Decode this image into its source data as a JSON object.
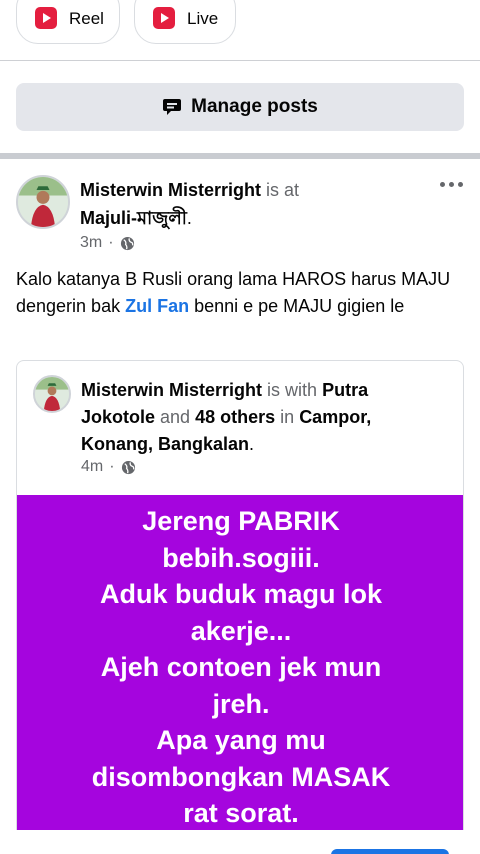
{
  "top_chips": [
    {
      "label": "Reel",
      "icon": "reel-icon"
    },
    {
      "label": "Live",
      "icon": "live-video-icon"
    }
  ],
  "manage": {
    "label": "Manage posts",
    "icon": "speech-bubble-icon"
  },
  "post": {
    "author": "Misterwin Misterright",
    "is_at": "is at",
    "location": "Majuli-মাজুলী",
    "location_suffix": ".",
    "time": "3m",
    "dot": "·",
    "text_part1": "Kalo katanya B Rusli orang lama HAROS harus MAJU dengerin bak ",
    "mention": "Zul Fan",
    "text_part2": " benni e pe MAJU gigien le",
    "audience_icon": "globe-icon"
  },
  "shared": {
    "author": "Misterwin Misterright",
    "is_with": "is with",
    "tagged": "Putra Jokotole",
    "and": "and",
    "others": "48 others",
    "in": "in",
    "place": "Campor, Konang, Bangkalan",
    "place_suffix": ".",
    "time": "4m",
    "dot": "·",
    "status_text": "Jereng PABRIK\nbebih.sogiii.\nAduk buduk magu lok\nakerje...\nAjeh contoen jek mun\njreh.\nApa yang mu\ndisombongkan MASAK\nrat sorat.",
    "background_color": "#a505de"
  }
}
